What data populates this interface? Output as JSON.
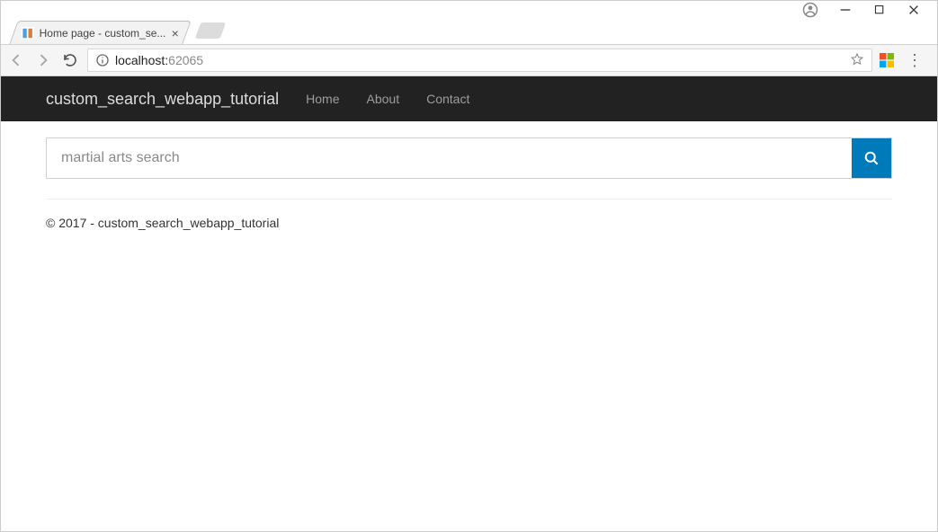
{
  "window": {
    "tab_title": "Home page - custom_se..."
  },
  "address": {
    "host": "localhost:",
    "port": "62065"
  },
  "navbar": {
    "brand": "custom_search_webapp_tutorial",
    "links": [
      "Home",
      "About",
      "Contact"
    ]
  },
  "search": {
    "placeholder": "martial arts search"
  },
  "footer": {
    "text": "© 2017 - custom_search_webapp_tutorial"
  }
}
